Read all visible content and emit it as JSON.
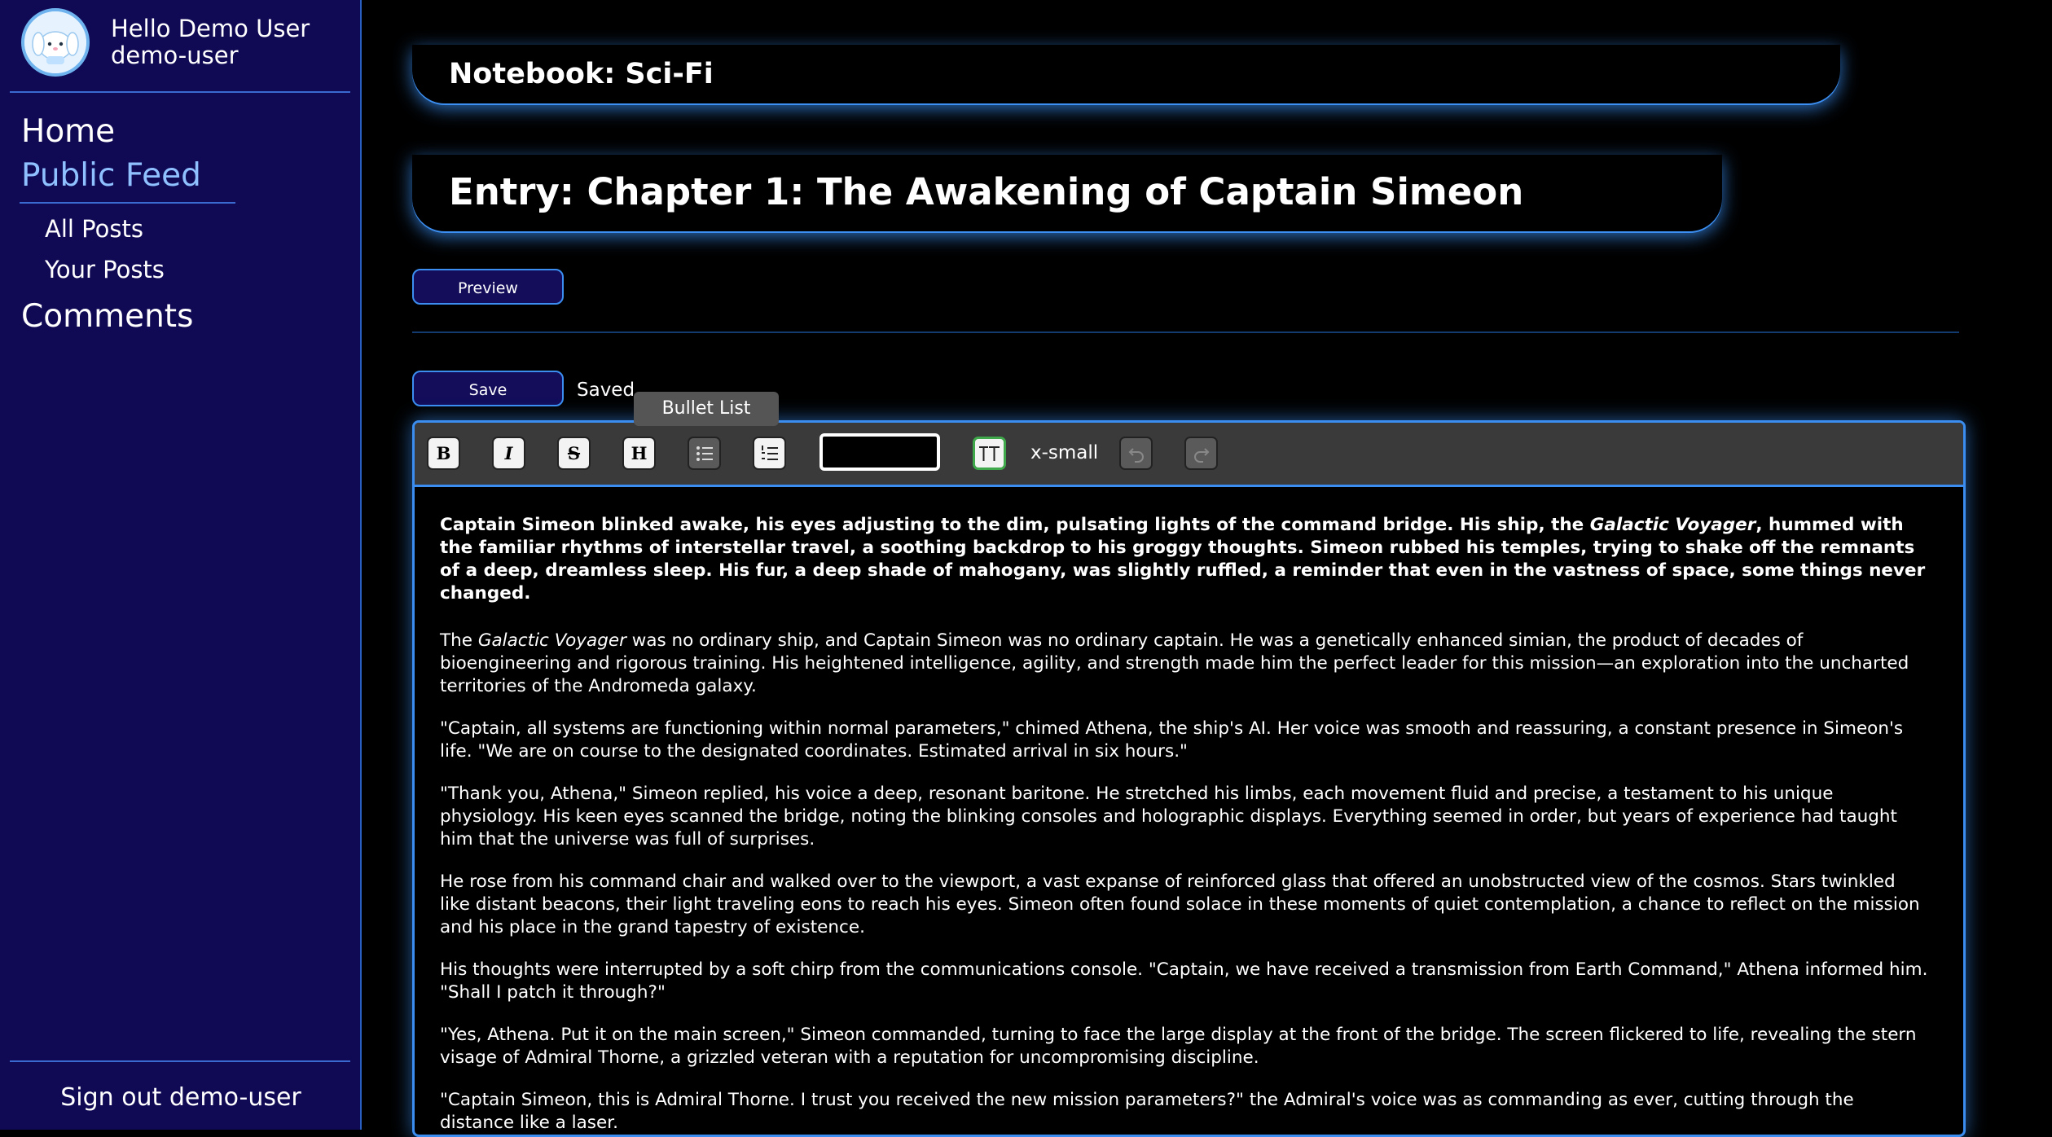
{
  "sidebar": {
    "greeting": "Hello Demo User",
    "username": "demo-user",
    "nav": {
      "home": "Home",
      "public_feed": "Public Feed",
      "all_posts": "All Posts",
      "your_posts": "Your Posts",
      "comments": "Comments"
    },
    "sign_out": "Sign out demo-user"
  },
  "notebook": {
    "title": "Notebook: Sci-Fi"
  },
  "entry": {
    "title": "Entry: Chapter 1: The Awakening of Captain Simeon"
  },
  "actions": {
    "preview": "Preview",
    "save": "Save",
    "status": "Saved"
  },
  "toolbar": {
    "bold": "B",
    "italic": "I",
    "strike": "S",
    "heading": "H",
    "tooltip": "Bullet List",
    "font_size": "x-small",
    "icons": [
      "bold-icon",
      "italic-icon",
      "strikethrough-icon",
      "heading-icon",
      "bullet-list-icon",
      "ordered-list-icon",
      "text-size-icon",
      "undo-icon",
      "redo-icon"
    ]
  },
  "content": {
    "p1_a": "Captain Simeon blinked awake, his eyes adjusting to the dim, pulsating lights of the command bridge. His ship, the ",
    "p1_ship": "Galactic Voyager",
    "p1_b": ", hummed with the familiar rhythms of interstellar travel, a soothing backdrop to his groggy thoughts. Simeon rubbed his temples, trying to shake off the remnants of a deep, dreamless sleep. His fur, a deep shade of mahogany, was slightly ruffled, a reminder that even in the vastness of space, some things never changed.",
    "p2_a": "The ",
    "p2_ship": "Galactic Voyager",
    "p2_b": " was no ordinary ship, and Captain Simeon was no ordinary captain. He was a genetically enhanced simian, the product of decades of bioengineering and rigorous training. His heightened intelligence, agility, and strength made him the perfect leader for this mission—an exploration into the uncharted territories of the Andromeda galaxy.",
    "p3": "\"Captain, all systems are functioning within normal parameters,\" chimed Athena, the ship's AI. Her voice was smooth and reassuring, a constant presence in Simeon's life. \"We are on course to the designated coordinates. Estimated arrival in six hours.\"",
    "p4": "\"Thank you, Athena,\" Simeon replied, his voice a deep, resonant baritone. He stretched his limbs, each movement fluid and precise, a testament to his unique physiology. His keen eyes scanned the bridge, noting the blinking consoles and holographic displays. Everything seemed in order, but years of experience had taught him that the universe was full of surprises.",
    "p5": "He rose from his command chair and walked over to the viewport, a vast expanse of reinforced glass that offered an unobstructed view of the cosmos. Stars twinkled like distant beacons, their light traveling eons to reach his eyes. Simeon often found solace in these moments of quiet contemplation, a chance to reflect on the mission and his place in the grand tapestry of existence.",
    "p6": "His thoughts were interrupted by a soft chirp from the communications console. \"Captain, we have received a transmission from Earth Command,\" Athena informed him. \"Shall I patch it through?\"",
    "p7": "\"Yes, Athena. Put it on the main screen,\" Simeon commanded, turning to face the large display at the front of the bridge. The screen flickered to life, revealing the stern visage of Admiral Thorne, a grizzled veteran with a reputation for uncompromising discipline.",
    "p8": "\"Captain Simeon, this is Admiral Thorne. I trust you received the new mission parameters?\" the Admiral's voice was as commanding as ever, cutting through the distance like a laser."
  }
}
